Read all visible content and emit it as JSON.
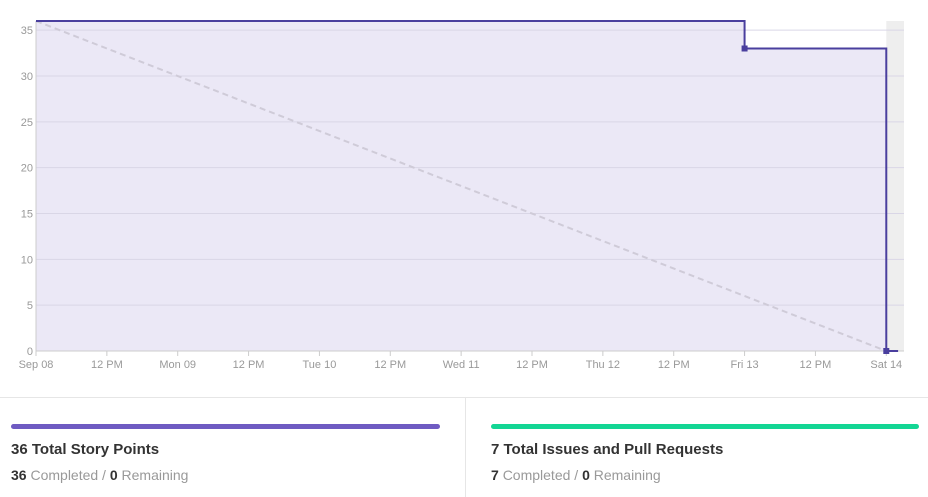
{
  "colors": {
    "line": "#4a3f9e",
    "fill": "#ebe8f6",
    "ideal": "#cfcbd8",
    "grid": "#d9d6e6",
    "future": "#eeeeee",
    "points_bar": "#6f5bc2",
    "issues_bar": "#13d694"
  },
  "chart_data": {
    "type": "line",
    "title": "",
    "xlabel": "",
    "ylabel": "",
    "ylim": [
      0,
      36
    ],
    "yticks": [
      0,
      5,
      10,
      15,
      20,
      25,
      30,
      35
    ],
    "x_range": [
      "2019-09-08T00:00",
      "2019-09-14T03:00"
    ],
    "x_tick_labels": [
      "Sep 08",
      "12 PM",
      "Mon 09",
      "12 PM",
      "Tue 10",
      "12 PM",
      "Wed 11",
      "12 PM",
      "Thu 12",
      "12 PM",
      "Fri 13",
      "12 PM",
      "Sat 14"
    ],
    "x_tick_values": [
      "2019-09-08T00:00",
      "2019-09-08T12:00",
      "2019-09-09T00:00",
      "2019-09-09T12:00",
      "2019-09-10T00:00",
      "2019-09-10T12:00",
      "2019-09-11T00:00",
      "2019-09-11T12:00",
      "2019-09-12T00:00",
      "2019-09-12T12:00",
      "2019-09-13T00:00",
      "2019-09-13T12:00",
      "2019-09-14T00:00"
    ],
    "future_from": "2019-09-14T00:00",
    "series": [
      {
        "style": "step",
        "points": [
          {
            "x": "2019-09-08T00:00",
            "y": 36
          },
          {
            "x": "2019-09-13T00:00",
            "y": 33,
            "marker": true
          },
          {
            "x": "2019-09-14T00:00",
            "y": 0,
            "marker": true
          },
          {
            "x": "2019-09-14T02:00",
            "y": 0
          }
        ]
      },
      {
        "style": "dashed",
        "points": [
          {
            "x": "2019-09-08T00:00",
            "y": 36
          },
          {
            "x": "2019-09-14T00:00",
            "y": 0
          }
        ]
      }
    ]
  },
  "summary": {
    "story_points": {
      "title": "36 Total Story Points",
      "completed": "36",
      "completed_label": "Completed /",
      "remaining": "0",
      "remaining_label": "Remaining"
    },
    "issues": {
      "title": "7 Total Issues and Pull Requests",
      "completed": "7",
      "completed_label": "Completed /",
      "remaining": "0",
      "remaining_label": "Remaining"
    }
  }
}
